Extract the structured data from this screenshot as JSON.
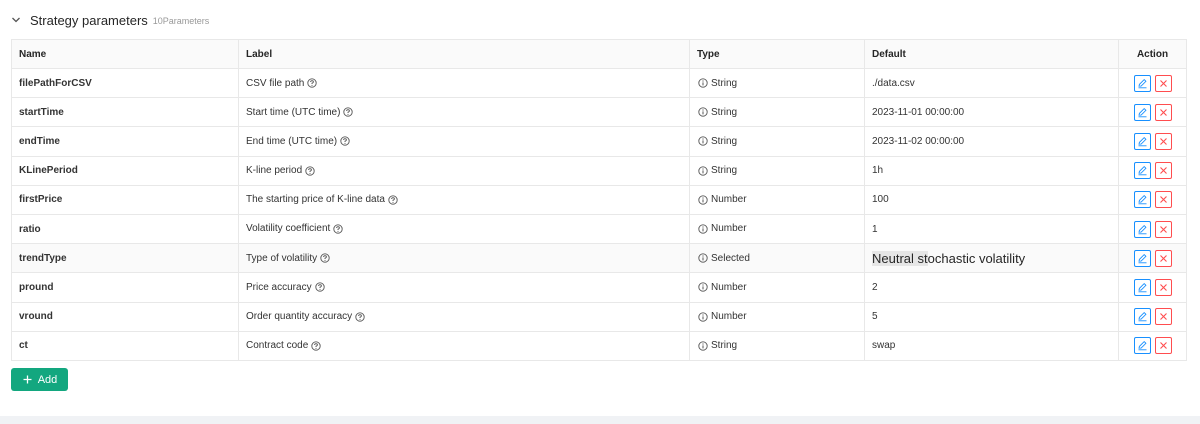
{
  "section": {
    "title": "Strategy parameters",
    "count": "10Parameters"
  },
  "table": {
    "headers": {
      "name": "Name",
      "label": "Label",
      "type": "Type",
      "default": "Default",
      "action": "Action"
    },
    "rows": [
      {
        "name": "filePathForCSV",
        "label": "CSV file path",
        "type": "String",
        "default": "./data.csv"
      },
      {
        "name": "startTime",
        "label": "Start time (UTC time)",
        "type": "String",
        "default": "2023-11-01 00:00:00"
      },
      {
        "name": "endTime",
        "label": "End time (UTC time)",
        "type": "String",
        "default": "2023-11-02 00:00:00"
      },
      {
        "name": "KLinePeriod",
        "label": "K-line period",
        "type": "String",
        "default": "1h"
      },
      {
        "name": "firstPrice",
        "label": "The starting price of K-line data",
        "type": "Number",
        "default": "100"
      },
      {
        "name": "ratio",
        "label": "Volatility coefficient",
        "type": "Number",
        "default": "1"
      },
      {
        "name": "trendType",
        "label": "Type of volatility",
        "type": "Selected",
        "default_part1": "Neutral st",
        "default_part2": "ochastic volatility"
      },
      {
        "name": "pround",
        "label": "Price accuracy",
        "type": "Number",
        "default": "2"
      },
      {
        "name": "vround",
        "label": "Order quantity accuracy",
        "type": "Number",
        "default": "5"
      },
      {
        "name": "ct",
        "label": "Contract code",
        "type": "String",
        "default": "swap"
      }
    ]
  },
  "add_button": {
    "label": "Add"
  },
  "colors": {
    "accent_green": "#13a77f",
    "edit_blue": "#1890ff",
    "delete_red": "#ff4d4f"
  },
  "icons": {
    "collapse": "chevron-down-icon",
    "help": "question-circle-icon",
    "type_info": "info-circle-icon",
    "edit": "edit-icon",
    "delete": "close-icon",
    "add": "plus-icon"
  }
}
